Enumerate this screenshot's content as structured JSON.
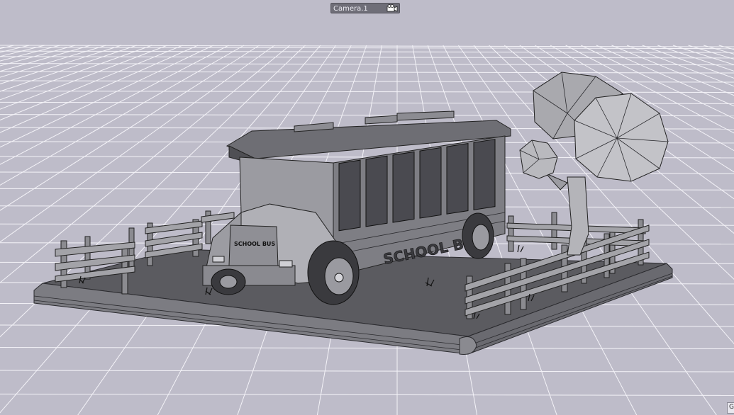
{
  "viewport": {
    "camera_name": "Camera.1",
    "camera_icon": "camera-icon",
    "corner_tab_label": "G",
    "background_color": "#bebcc9",
    "grid_color": "#f4f3f8"
  },
  "scene": {
    "front_sign_text": "SCHOOL BUS",
    "side_text": "SCHOOL BUS"
  }
}
